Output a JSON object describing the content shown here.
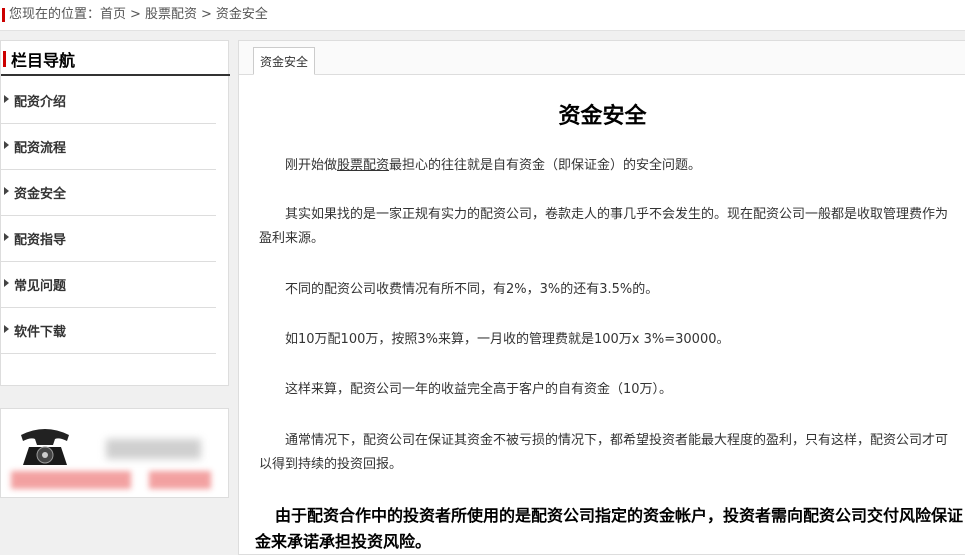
{
  "breadcrumb": {
    "prefix": "您现在的位置：",
    "items": [
      "首页",
      "股票配资",
      "资金安全"
    ],
    "separator": ">"
  },
  "sidebar": {
    "title": "栏目导航",
    "items": [
      {
        "label": "配资介绍"
      },
      {
        "label": "配资流程"
      },
      {
        "label": "资金安全"
      },
      {
        "label": "配资指导"
      },
      {
        "label": "常见问题"
      },
      {
        "label": "软件下载"
      }
    ]
  },
  "contact": {
    "icon": "telephone-icon"
  },
  "main": {
    "tab_label": "资金安全",
    "title": "资金安全",
    "p1_before": "刚开始做",
    "p1_link": "股票配资",
    "p1_after": "最担心的往往就是自有资金（即保证金）的安全问题。",
    "p2": "其实如果找的是一家正规有实力的配资公司，卷款走人的事几乎不会发生的。现在配资公司一般都是收取管理费作为盈利来源。",
    "p3": "不同的配资公司收费情况有所不同，有2%，3%的还有3.5%的。",
    "p4": "如10万配100万，按照3%来算，一月收的管理费就是100万x 3%=30000。",
    "p5": "这样来算，配资公司一年的收益完全高于客户的自有资金（10万）。",
    "p6": "通常情况下，配资公司在保证其资金不被亏损的情况下，都希望投资者能最大程度的盈利，只有这样，配资公司才可以得到持续的投资回报。",
    "p7": "由于配资合作中的投资者所使用的是配资公司指定的资金帐户，投资者需向配资公司交付风险保证金来承诺承担投资风险。"
  },
  "colors": {
    "accent": "#cc0000"
  }
}
